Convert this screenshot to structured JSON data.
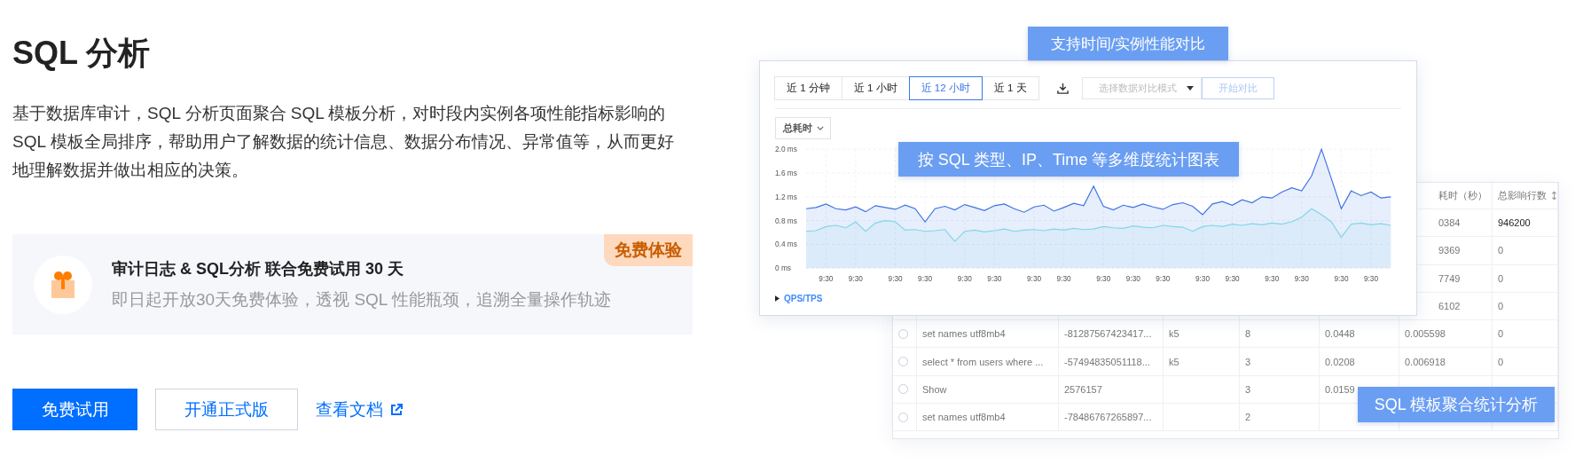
{
  "title": "SQL 分析",
  "description": "基于数据库审计，SQL 分析页面聚合 SQL 模板分析，对时段内实例各项性能指标影响的 SQL 模板全局排序，帮助用户了解数据的统计信息、数据分布情况、异常值等，从而更好地理解数据并做出相应的决策。",
  "promo": {
    "badge": "免费体验",
    "title": "审计日志 & SQL分析 联合免费试用 30 天",
    "subtitle": "即日起开放30天免费体验，透视 SQL 性能瓶颈，追溯全量操作轨迹"
  },
  "actions": {
    "primary": "免费试用",
    "secondary": "开通正式版",
    "link": "查看文档"
  },
  "illustration": {
    "compare_callout": "支持时间/实例性能对比",
    "chart_callout": "按 SQL 类型、IP、Time 等多维度统计图表",
    "table_callout": "SQL 模板聚合统计分析",
    "chart_panel": {
      "time_ranges": [
        {
          "label": "近 1 分钟",
          "selected": false
        },
        {
          "label": "近 1 小时",
          "selected": false
        },
        {
          "label": "近 12 小时",
          "selected": true
        },
        {
          "label": "近 1 天",
          "selected": false
        }
      ],
      "compare_select": {
        "placeholder": "选择数据对比模式"
      },
      "compare_button": "开始对比",
      "metric_dropdown": "总耗时",
      "chart_data": {
        "type": "area",
        "ylim": [
          0,
          2
        ],
        "grid": true,
        "categories": [
          null,
          null,
          "9:30",
          null,
          null,
          "9:30",
          null,
          null,
          null,
          "9:30",
          null,
          null,
          "9:30",
          null,
          null,
          null,
          "9:30",
          null,
          null,
          "9:30",
          null,
          null,
          null,
          "9:30",
          null,
          null,
          "9:30",
          null,
          null,
          null,
          "9:30",
          null,
          null,
          "9:30",
          null,
          null,
          "9:30",
          null,
          null,
          null,
          "9:30",
          null,
          null,
          "9:30",
          null,
          null,
          null,
          "9:30",
          null,
          null,
          "9:30",
          null,
          null,
          null,
          "9:30",
          null,
          null,
          "9:30",
          null,
          null
        ],
        "yticks": [
          {
            "value": 0,
            "label": "0 ms"
          },
          {
            "value": 0.4,
            "label": "0.4 ms"
          },
          {
            "value": 0.8,
            "label": "0.8 ms"
          },
          {
            "value": 1.2,
            "label": "1.2 ms"
          },
          {
            "value": 1.6,
            "label": "1.6 ms"
          },
          {
            "value": 2,
            "label": "2.0 ms"
          }
        ],
        "series": [
          {
            "color": "#3d72e3",
            "values": [
              1.0,
              1.02,
              1.08,
              1.0,
              0.98,
              1.03,
              0.95,
              1.05,
              1.02,
              0.99,
              1.06,
              1.0,
              0.78,
              1.0,
              1.04,
              0.98,
              1.07,
              1.02,
              0.97,
              1.05,
              1.08,
              1.0,
              0.94,
              1.03,
              1.06,
              0.96,
              1.02,
              1.09,
              1.05,
              1.38,
              1.04,
              0.98,
              1.06,
              1.02,
              1.08,
              1.03,
              0.99,
              1.07,
              1.1,
              1.04,
              0.9,
              1.08,
              1.12,
              1.06,
              1.15,
              1.1,
              1.2,
              1.18,
              1.28,
              1.35,
              1.3,
              1.55,
              2.0,
              1.5,
              1.0,
              1.3,
              1.22,
              1.28,
              1.18,
              1.2
            ]
          },
          {
            "color": "#80d7e6",
            "values": [
              0.62,
              0.63,
              0.7,
              0.72,
              0.68,
              0.78,
              0.62,
              0.76,
              0.8,
              0.78,
              0.64,
              0.65,
              0.62,
              0.63,
              0.65,
              0.45,
              0.62,
              0.64,
              0.61,
              0.63,
              0.66,
              0.62,
              0.64,
              0.65,
              0.63,
              0.66,
              0.64,
              0.67,
              0.65,
              0.66,
              0.7,
              0.68,
              0.67,
              0.71,
              0.69,
              0.68,
              0.72,
              0.7,
              0.69,
              0.62,
              0.7,
              0.72,
              0.7,
              0.74,
              0.72,
              0.75,
              0.73,
              0.76,
              0.74,
              0.78,
              0.86,
              1.0,
              0.9,
              0.78,
              0.52,
              0.74,
              0.76,
              0.73,
              0.75,
              0.72
            ]
          }
        ]
      },
      "expand_link": "QPS/TPS"
    },
    "table": {
      "header": {
        "column_7": "耗时（秒）",
        "column_8": "总影响行数"
      },
      "rows": [
        {
          "column_7": "0384",
          "column_8": "946200"
        },
        {
          "column_7": "9369",
          "column_8": "0"
        },
        {
          "column_7": "7749",
          "column_8": "0"
        },
        {
          "column_7": "6102",
          "column_8": "0"
        },
        {
          "selected": false,
          "column_2": "set names utf8mb4",
          "column_3": "-81287567423417...",
          "column_4": "k5",
          "column_5": "8",
          "column_6": "0.0448",
          "column_7": "0.005598",
          "column_8": "0"
        },
        {
          "selected": false,
          "column_2": "select * from users where ...",
          "column_3": "-57494835051118...",
          "column_4": "k5",
          "column_5": "3",
          "column_6": "0.0208",
          "column_7": "0.006918",
          "column_8": "0"
        },
        {
          "selected": false,
          "column_2": "Show",
          "column_3": "2576157",
          "column_5": "3",
          "column_6": "0.0159"
        },
        {
          "selected": false,
          "column_2": "set names utf8mb4",
          "column_3": "-78486767265897...",
          "column_5": "2"
        }
      ]
    }
  }
}
